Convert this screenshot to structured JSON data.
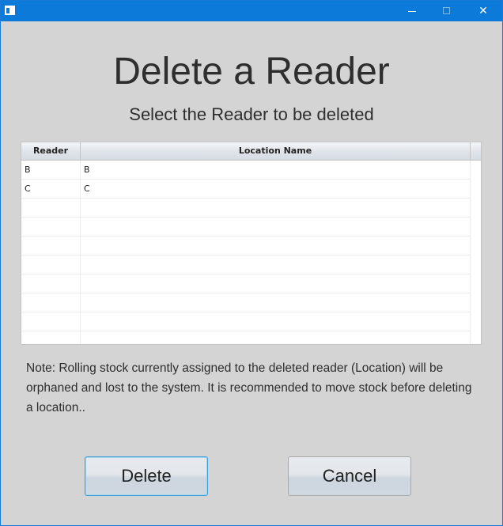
{
  "window": {
    "title": "",
    "controls": {
      "minimize_icon": "—",
      "maximize_icon": "",
      "close_icon": "✕"
    }
  },
  "heading": "Delete a Reader",
  "subheading": "Select the Reader to be deleted",
  "table": {
    "columns": [
      "Reader",
      "Location Name"
    ],
    "rows": [
      [
        "B",
        "B"
      ],
      [
        "C",
        "C"
      ]
    ],
    "empty_rows": 8
  },
  "note": "Note:  Rolling stock currently assigned to the deleted reader (Location) will be orphaned and lost to the system. It is recommended to move stock before deleting a location..",
  "buttons": {
    "delete_label": "Delete",
    "cancel_label": "Cancel"
  },
  "colors": {
    "titlebar": "#0b7ad9",
    "dialog_bg": "#d4d4d4",
    "focus_border": "#3d9fd8"
  }
}
